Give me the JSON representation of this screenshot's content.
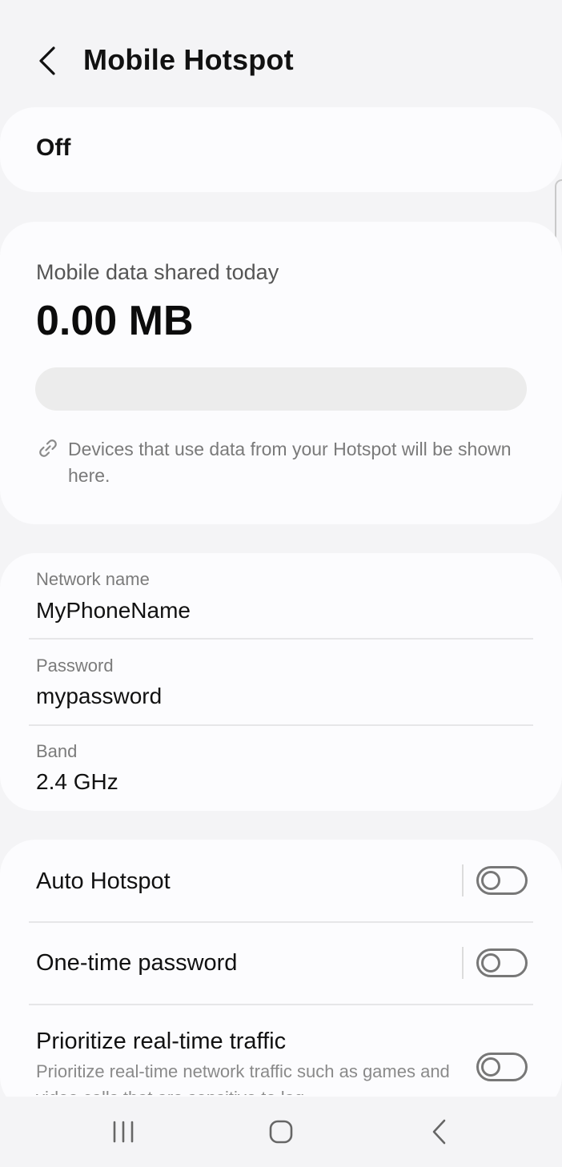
{
  "header": {
    "title": "Mobile Hotspot",
    "back_icon": "chevron-left-icon"
  },
  "master_switch": {
    "label": "Off",
    "enabled": false
  },
  "usage": {
    "label": "Mobile data shared today",
    "value": "0.00 MB",
    "fill_fraction": 0,
    "hint_icon": "link-icon",
    "hint": "Devices that use data from your Hotspot will be shown here."
  },
  "network": {
    "fields": [
      {
        "label": "Network name",
        "value": "MyPhoneName"
      },
      {
        "label": "Password",
        "value": "mypassword"
      },
      {
        "label": "Band",
        "value": "2.4 GHz"
      }
    ]
  },
  "options": [
    {
      "label": "Auto Hotspot",
      "enabled": false
    },
    {
      "label": "One-time password",
      "enabled": false
    },
    {
      "label": "Prioritize real-time traffic",
      "sub": "Prioritize real-time network traffic such as games and video calls that are sensitive to lag.",
      "enabled": false
    }
  ],
  "nav": {
    "recents_icon": "recent-apps-icon",
    "home_icon": "home-icon",
    "back_icon": "back-icon"
  },
  "colors": {
    "background": "#f4f4f6",
    "card": "#fcfcfe",
    "toggle_off": "#777777"
  }
}
